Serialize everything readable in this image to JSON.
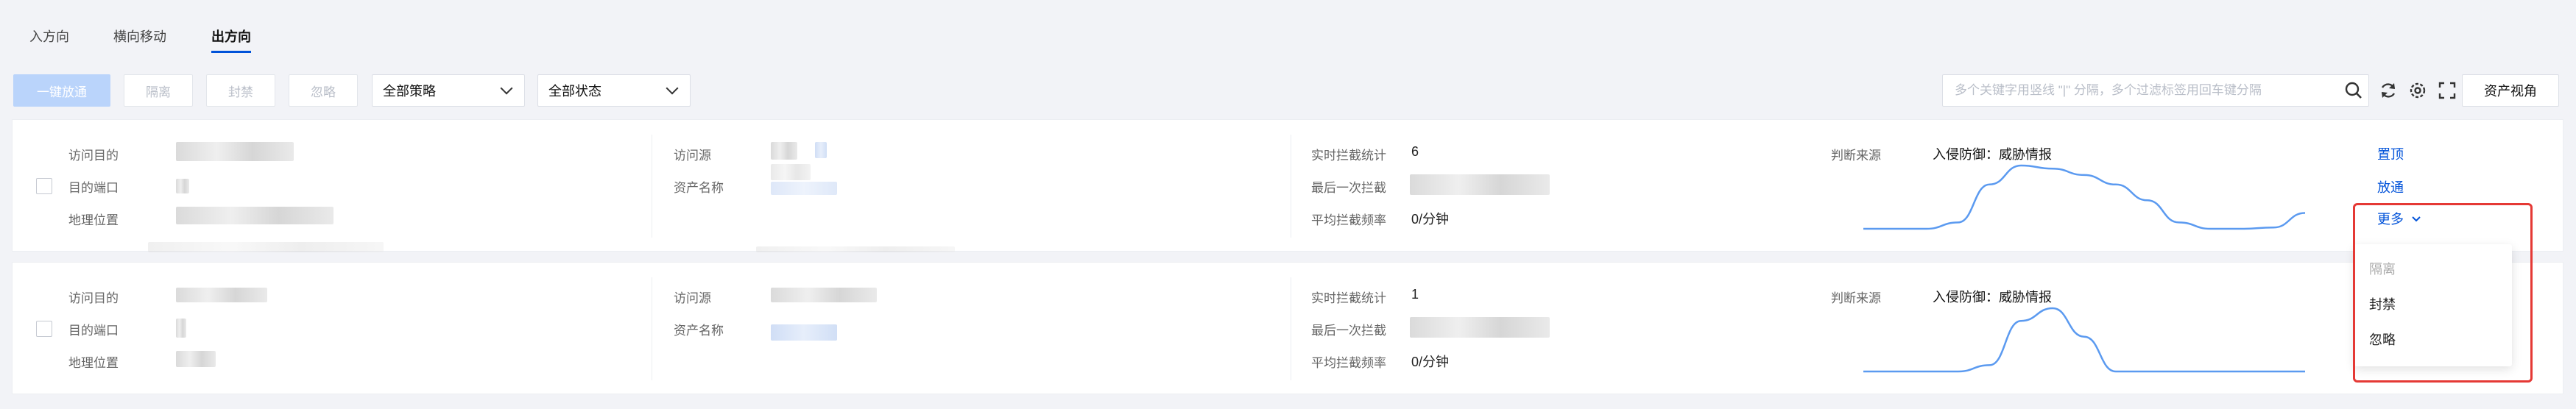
{
  "tabs": [
    {
      "label": "入方向",
      "active": false
    },
    {
      "label": "横向移动",
      "active": false
    },
    {
      "label": "出方向",
      "active": true
    }
  ],
  "toolbar": {
    "release_all_label": "一键放通",
    "isolate_label": "隔离",
    "block_label": "封禁",
    "ignore_label": "忽略",
    "policy_select": "全部策略",
    "status_select": "全部状态",
    "search_placeholder": "多个关键字用竖线 \"|\" 分隔，多个过滤标签用回车键分隔",
    "asset_view_label": "资产视角"
  },
  "labels": {
    "visit_target": "访问目的",
    "target_port": "目的端口",
    "geo_location": "地理位置",
    "visit_source": "访问源",
    "asset_name": "资产名称",
    "realtime_stats": "实时拦截统计",
    "last_block": "最后一次拦截",
    "avg_rate": "平均拦截频率",
    "judge_source": "判断来源"
  },
  "cards": [
    {
      "realtime_count": "6",
      "avg_rate": "0/分钟",
      "judge_value": "入侵防御：威胁情报",
      "actions": {
        "top": "置顶",
        "release": "放通",
        "more": "更多"
      },
      "spark": [
        0,
        0,
        0,
        0.1,
        0.7,
        1.0,
        0.95,
        0.85,
        0.7,
        0.45,
        0.1,
        0,
        0,
        0.02,
        0.25
      ]
    },
    {
      "realtime_count": "1",
      "avg_rate": "0/分钟",
      "judge_value": "入侵防御：威胁情报",
      "spark": [
        0,
        0,
        0,
        0,
        0.1,
        0.8,
        1.0,
        0.55,
        0,
        0,
        0,
        0,
        0,
        0,
        0
      ]
    }
  ],
  "dropdown": {
    "items": [
      {
        "label": "隔离",
        "disabled": true
      },
      {
        "label": "封禁",
        "disabled": false
      },
      {
        "label": "忽略",
        "disabled": false
      }
    ]
  },
  "colors": {
    "accent": "#0052d9",
    "sparkline": "#5b9af0",
    "highlight": "#e53935"
  }
}
